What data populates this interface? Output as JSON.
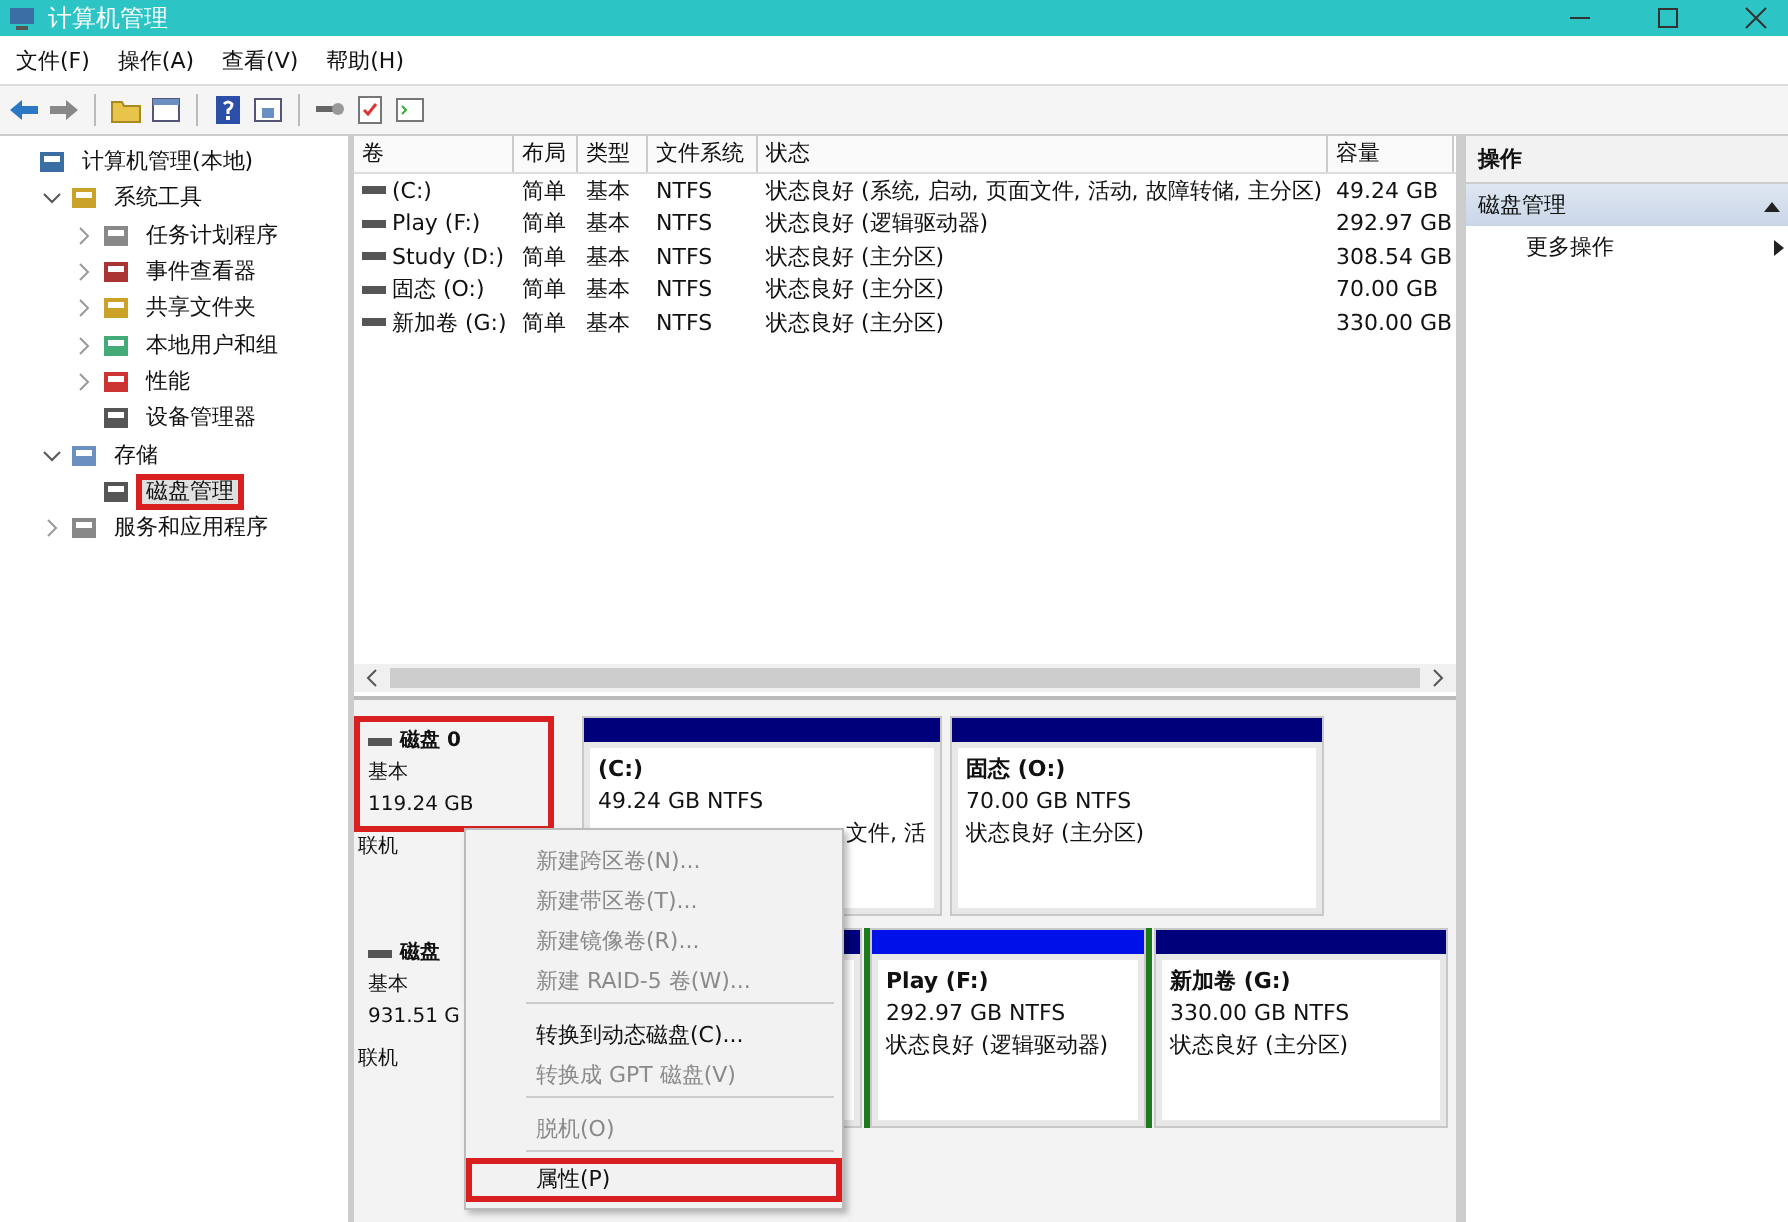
{
  "window": {
    "title": "计算机管理"
  },
  "menu_bar": [
    "文件(F)",
    "操作(A)",
    "查看(V)",
    "帮助(H)"
  ],
  "tree": [
    {
      "label": "计算机管理(本地)",
      "children": [
        {
          "label": "系统工具",
          "expanded": true,
          "children": [
            {
              "label": "任务计划程序",
              "expanded": false
            },
            {
              "label": "事件查看器",
              "expanded": false
            },
            {
              "label": "共享文件夹",
              "expanded": false
            },
            {
              "label": "本地用户和组",
              "expanded": false
            },
            {
              "label": "性能",
              "expanded": false
            },
            {
              "label": "设备管理器"
            }
          ]
        },
        {
          "label": "存储",
          "expanded": true,
          "children": [
            {
              "label": "磁盘管理",
              "selected": true,
              "highlighted": true
            }
          ]
        },
        {
          "label": "服务和应用程序",
          "expanded": false
        }
      ]
    }
  ],
  "volume_table": {
    "columns": [
      "卷",
      "布局",
      "类型",
      "文件系统",
      "状态",
      "容量"
    ],
    "rows": [
      [
        "(C:)",
        "简单",
        "基本",
        "NTFS",
        "状态良好 (系统, 启动, 页面文件, 活动, 故障转储, 主分区)",
        "49.24 GB"
      ],
      [
        "Play (F:)",
        "简单",
        "基本",
        "NTFS",
        "状态良好 (逻辑驱动器)",
        "292.97 GB"
      ],
      [
        "Study (D:)",
        "简单",
        "基本",
        "NTFS",
        "状态良好 (主分区)",
        "308.54 GB"
      ],
      [
        "固态 (O:)",
        "简单",
        "基本",
        "NTFS",
        "状态良好 (主分区)",
        "70.00 GB"
      ],
      [
        "新加卷 (G:)",
        "简单",
        "基本",
        "NTFS",
        "状态良好 (主分区)",
        "330.00 GB"
      ]
    ]
  },
  "disks": [
    {
      "name": "磁盘 0",
      "type": "基本",
      "size": "119.24 GB",
      "state": "联机",
      "highlighted": true,
      "partitions": [
        {
          "name": "(C:)",
          "size": "49.24 GB NTFS",
          "status": "文件, 活",
          "selected": false
        },
        {
          "name": "固态  (O:)",
          "size": "70.00 GB NTFS",
          "status": "状态良好 (主分区)",
          "selected": false
        }
      ]
    },
    {
      "name": "磁盘",
      "type": "基本",
      "size": "931.51 G",
      "state": "联机",
      "partitions": [
        {
          "selected": false
        },
        {
          "name": "Play  (F:)",
          "size": "292.97 GB NTFS",
          "status": "状态良好 (逻辑驱动器)",
          "selected": true
        },
        {
          "name": "新加卷  (G:)",
          "size": "330.00 GB NTFS",
          "status": "状态良好 (主分区)",
          "selected": false
        }
      ]
    }
  ],
  "context_menu": [
    {
      "kind": "item",
      "label": "新建跨区卷(N)...",
      "disabled": true,
      "highlighted": false
    },
    {
      "kind": "item",
      "label": "新建带区卷(T)...",
      "disabled": true,
      "highlighted": false
    },
    {
      "kind": "item",
      "label": "新建镜像卷(R)...",
      "disabled": true,
      "highlighted": false
    },
    {
      "kind": "item",
      "label": "新建 RAID-5 卷(W)...",
      "disabled": true,
      "highlighted": false
    },
    {
      "kind": "separator"
    },
    {
      "kind": "item",
      "label": "转换到动态磁盘(C)...",
      "disabled": false,
      "highlighted": false
    },
    {
      "kind": "item",
      "label": "转换成 GPT 磁盘(V)",
      "disabled": true,
      "highlighted": false
    },
    {
      "kind": "separator"
    },
    {
      "kind": "item",
      "label": "脱机(O)",
      "disabled": true,
      "highlighted": false
    },
    {
      "kind": "separator"
    },
    {
      "kind": "item",
      "label": "属性(P)",
      "disabled": false,
      "highlighted": true
    }
  ],
  "actions": {
    "title": "操作",
    "groups": [
      {
        "label": "磁盘管理",
        "items": [
          "更多操作"
        ]
      }
    ]
  }
}
